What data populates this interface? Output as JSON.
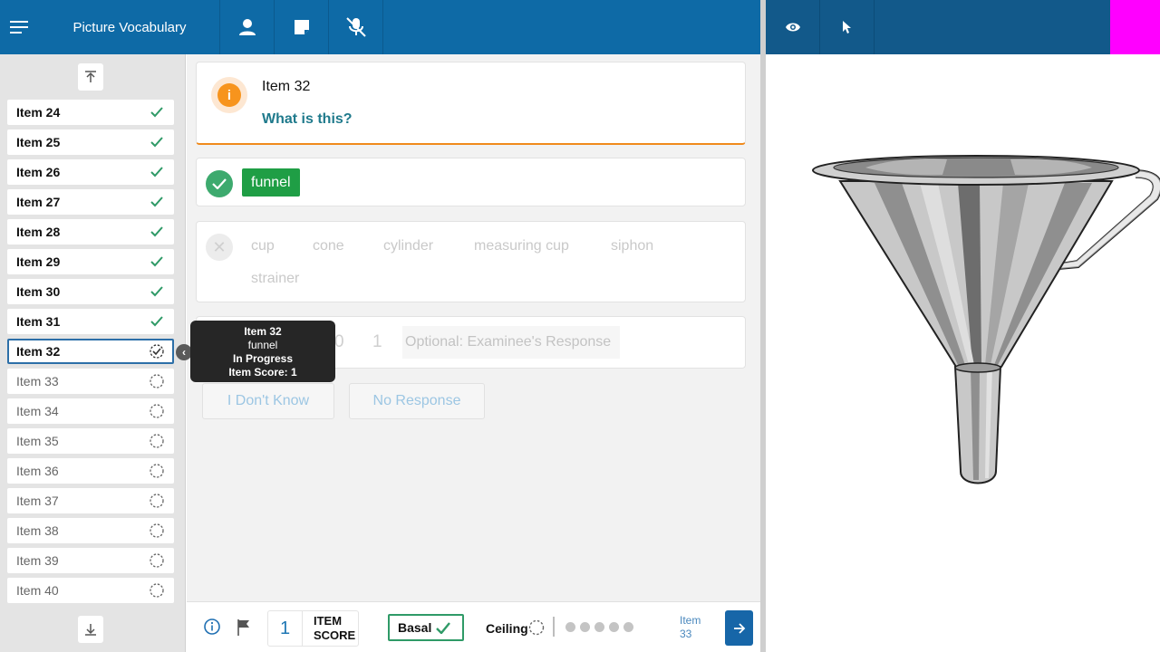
{
  "app": {
    "title": "Picture Vocabulary",
    "menu_icon": "hamburger-menu-icon",
    "toolbar_icons": [
      "person-icon",
      "note-icon",
      "mic-off-icon"
    ],
    "right_toolbar_icons": [
      "eye-icon",
      "pointer-icon"
    ],
    "accent_color": "#0e6aa6",
    "magenta_block": "#ff00ff"
  },
  "sidebar": {
    "items": [
      {
        "label": "Item 24",
        "status": "done"
      },
      {
        "label": "Item 25",
        "status": "done"
      },
      {
        "label": "Item 26",
        "status": "done"
      },
      {
        "label": "Item 27",
        "status": "done"
      },
      {
        "label": "Item 28",
        "status": "done"
      },
      {
        "label": "Item 29",
        "status": "done"
      },
      {
        "label": "Item 30",
        "status": "done"
      },
      {
        "label": "Item 31",
        "status": "done"
      },
      {
        "label": "Item 32",
        "status": "current"
      },
      {
        "label": "Item 33",
        "status": "todo"
      },
      {
        "label": "Item 34",
        "status": "todo"
      },
      {
        "label": "Item 35",
        "status": "todo"
      },
      {
        "label": "Item 36",
        "status": "todo"
      },
      {
        "label": "Item 37",
        "status": "todo"
      },
      {
        "label": "Item 38",
        "status": "todo"
      },
      {
        "label": "Item 39",
        "status": "todo"
      },
      {
        "label": "Item 40",
        "status": "todo"
      }
    ]
  },
  "tooltip": {
    "line1": "Item 32",
    "line2": "funnel",
    "line3": "In Progress",
    "line4": "Item Score: 1"
  },
  "question": {
    "item": "Item 32",
    "prompt": "What is this?"
  },
  "correct_answer": "funnel",
  "wrong_options": [
    "cup",
    "cone",
    "cylinder",
    "measuring cup",
    "siphon",
    "strainer"
  ],
  "scoring": {
    "values": [
      "0",
      "1"
    ],
    "response_placeholder": "Optional: Examinee's Response"
  },
  "buttons": {
    "dont_know": "I Don't Know",
    "no_response": "No Response"
  },
  "bottombar": {
    "item_score_value": "1",
    "item_score_label_1": "ITEM",
    "item_score_label_2": "SCORE",
    "basal_label": "Basal",
    "ceiling_label": "Ceiling",
    "dot_count": 5,
    "next_label_1": "Item",
    "next_label_2": "33"
  }
}
